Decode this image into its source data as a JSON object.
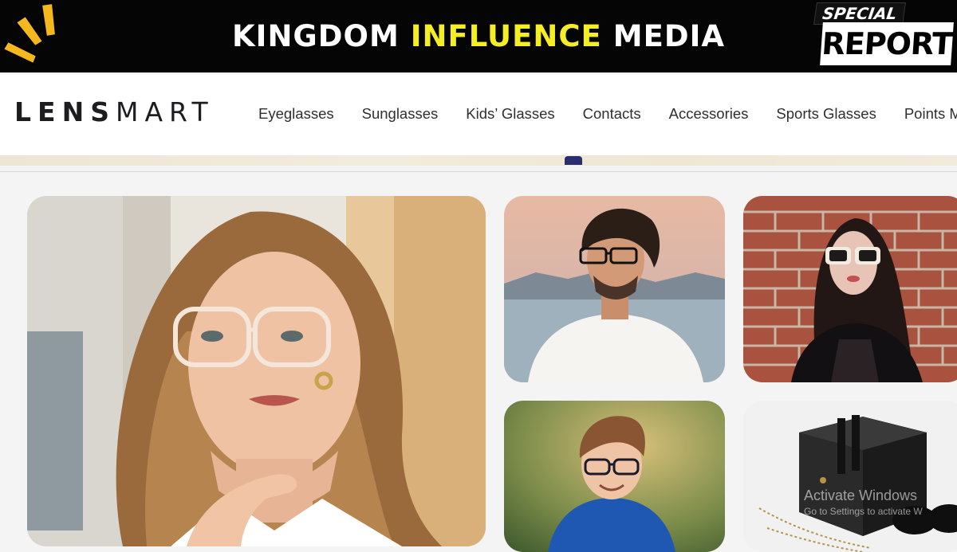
{
  "banner": {
    "title_part1": "KINGDOM",
    "title_accent": "INFLUENCE",
    "title_part2": "MEDIA",
    "badge_top": "SPECIAL",
    "badge_bottom": "REPORT",
    "accent_color": "#f5ee25"
  },
  "header": {
    "logo_bold": "LENS",
    "logo_light": "MART",
    "nav": [
      {
        "label": "Eyeglasses"
      },
      {
        "label": "Sunglasses"
      },
      {
        "label": "Kids’ Glasses"
      },
      {
        "label": "Contacts"
      },
      {
        "label": "Accessories"
      },
      {
        "label": "Sports Glasses"
      },
      {
        "label": "Points Mal"
      }
    ]
  },
  "gallery": {
    "images": [
      {
        "name": "woman-in-clear-eyeglasses"
      },
      {
        "name": "man-in-black-eyeglasses"
      },
      {
        "name": "woman-in-white-sunglasses"
      },
      {
        "name": "boy-in-kids-glasses"
      },
      {
        "name": "glasses-case-with-chains"
      }
    ]
  },
  "watermark": {
    "line1": "Activate Windows",
    "line2": "Go to Settings to activate W"
  }
}
